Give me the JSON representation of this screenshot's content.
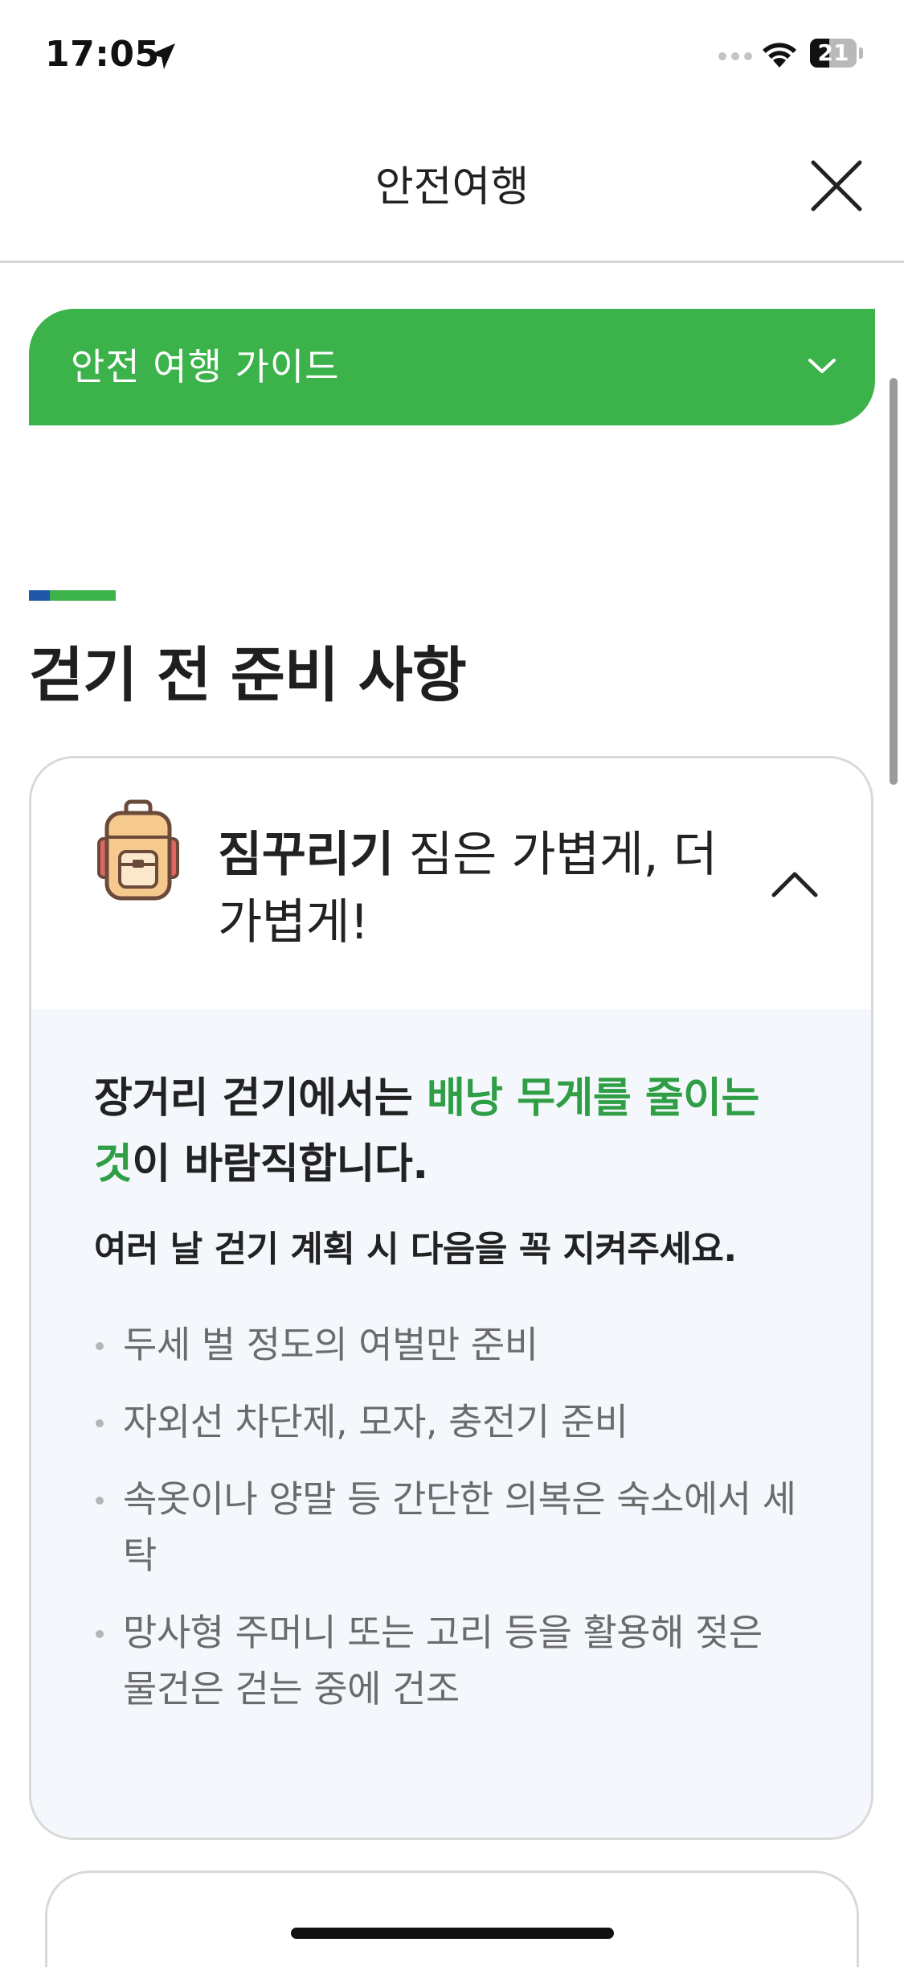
{
  "status_bar": {
    "time": "17:05",
    "battery": "21",
    "icons": [
      "location-arrow-icon",
      "signal-dots-icon",
      "wifi-icon",
      "battery-icon"
    ]
  },
  "header": {
    "title": "안전여행",
    "close_icon": "close-icon"
  },
  "guide_dropdown": {
    "label": "안전 여행 가이드",
    "icon": "chevron-down-icon",
    "color": "#3cb24a"
  },
  "section": {
    "title": "걷기 전 준비 사항"
  },
  "accordion": {
    "icon": "backpack-icon",
    "title_strong": "짐꾸리기",
    "title_rest": " 짐은 가볍게, 더 가볍게!",
    "toggle_icon": "chevron-up-icon",
    "expanded": true,
    "lead_pre": "장거리 걷기에서는 ",
    "lead_highlight": "배낭 무게를 줄이는 것",
    "lead_post": "이 바람직합니다.",
    "subhead": "여러 날 걷기 계획 시 다음을 꼭 지켜주세요.",
    "bullets": [
      "두세 벌 정도의 여벌만 준비",
      "자외선 차단제, 모자, 충전기 준비",
      "속옷이나 양말 등 간단한 의복은 숙소에서 세탁",
      "망사형 주머니 또는 고리 등을 활용해 젖은 물건은 걷는 중에 건조"
    ]
  },
  "colors": {
    "accent_green": "#3cb24a",
    "accent_blue": "#1f56a8",
    "highlight_text": "#2f9e44",
    "card_body_bg": "#f4f8fd"
  }
}
